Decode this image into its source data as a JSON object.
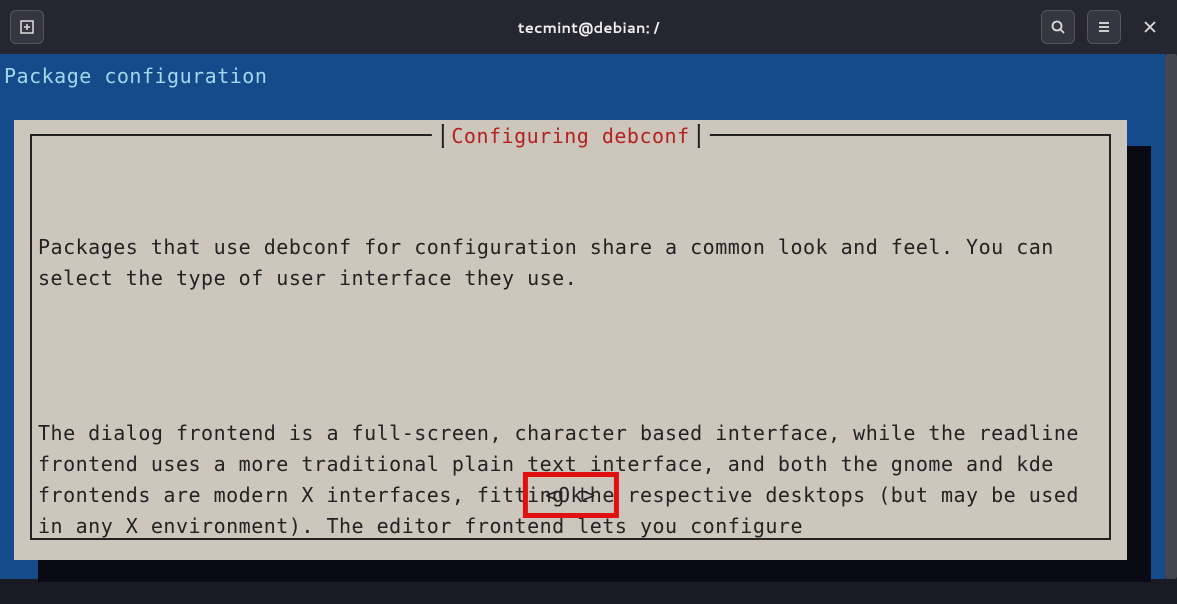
{
  "window": {
    "title": "tecmint@debian: /"
  },
  "terminal": {
    "header": "Package configuration"
  },
  "dialog": {
    "title": "Configuring debconf",
    "paragraph1": "Packages that use debconf for configuration share a common look and feel. You can select the type of user interface they use.",
    "paragraph2": "The dialog frontend is a full-screen, character based interface, while the readline frontend uses a more traditional plain text interface, and both the gnome and kde frontends are modern X interfaces, fitting the respective desktops (but may be used in any X environment). The editor frontend lets you configure",
    "ok_label": "<Ok>"
  }
}
